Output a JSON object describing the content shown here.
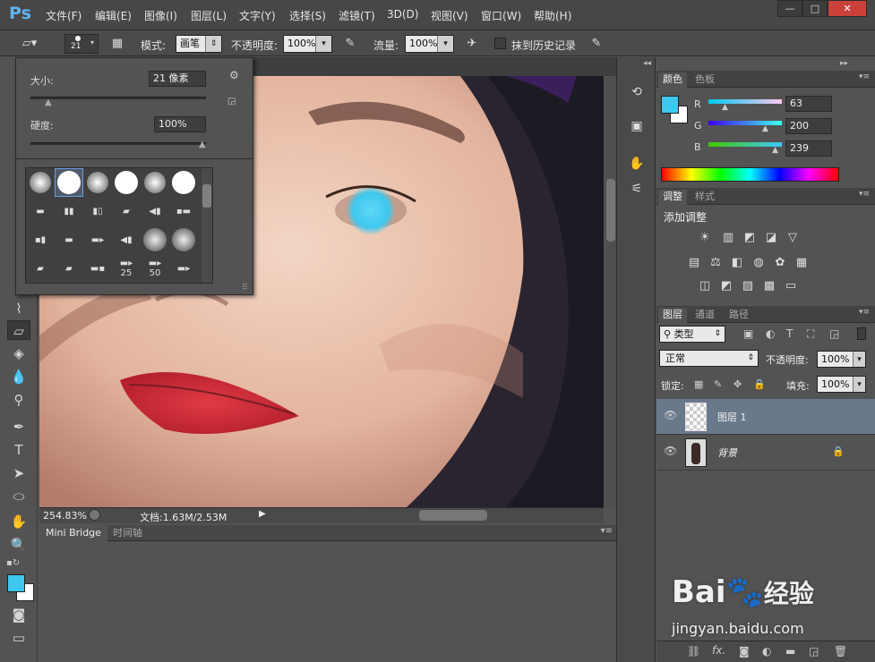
{
  "app": {
    "logo": "Ps"
  },
  "menu": [
    "文件(F)",
    "编辑(E)",
    "图像(I)",
    "图层(L)",
    "文字(Y)",
    "选择(S)",
    "滤镜(T)",
    "3D(D)",
    "视图(V)",
    "窗口(W)",
    "帮助(H)"
  ],
  "window_controls": {
    "minimize": "—",
    "maximize": "□",
    "close": "✕"
  },
  "options": {
    "brush_size": "21",
    "mode_label": "模式:",
    "mode_value": "画笔",
    "opacity_label": "不透明度:",
    "opacity_value": "100%",
    "flow_label": "流量:",
    "flow_value": "100%",
    "erase_history_label": "抹到历史记录"
  },
  "brush_popup": {
    "size_label": "大小:",
    "size_value": "21 像素",
    "hardness_label": "硬度:",
    "hardness_value": "100%",
    "preset_counts": [
      "25",
      "50"
    ]
  },
  "status": {
    "zoom": "254.83%",
    "doc_info": "文档:1.63M/2.53M"
  },
  "bottom_tabs": [
    "Mini Bridge",
    "时间轴"
  ],
  "color_panel": {
    "tabs": [
      "颜色",
      "色板"
    ],
    "r_label": "R",
    "r_value": "63",
    "g_label": "G",
    "g_value": "200",
    "b_label": "B",
    "b_value": "239",
    "foreground_color": "#3fc8ef",
    "background_color": "#ffffff"
  },
  "adjust_panel": {
    "tabs": [
      "调整",
      "样式"
    ],
    "title": "添加调整"
  },
  "layers_panel": {
    "tabs": [
      "图层",
      "通道",
      "路径"
    ],
    "filter_label": "类型",
    "blend_mode": "正常",
    "opacity_label": "不透明度:",
    "opacity_value": "100%",
    "lock_label": "锁定:",
    "fill_label": "填充:",
    "fill_value": "100%",
    "layers": [
      {
        "name": "图层 1"
      },
      {
        "name": "背景"
      }
    ]
  },
  "watermark": {
    "brand": "Bai",
    "brand2": "经验",
    "url": "jingyan.baidu.com"
  }
}
